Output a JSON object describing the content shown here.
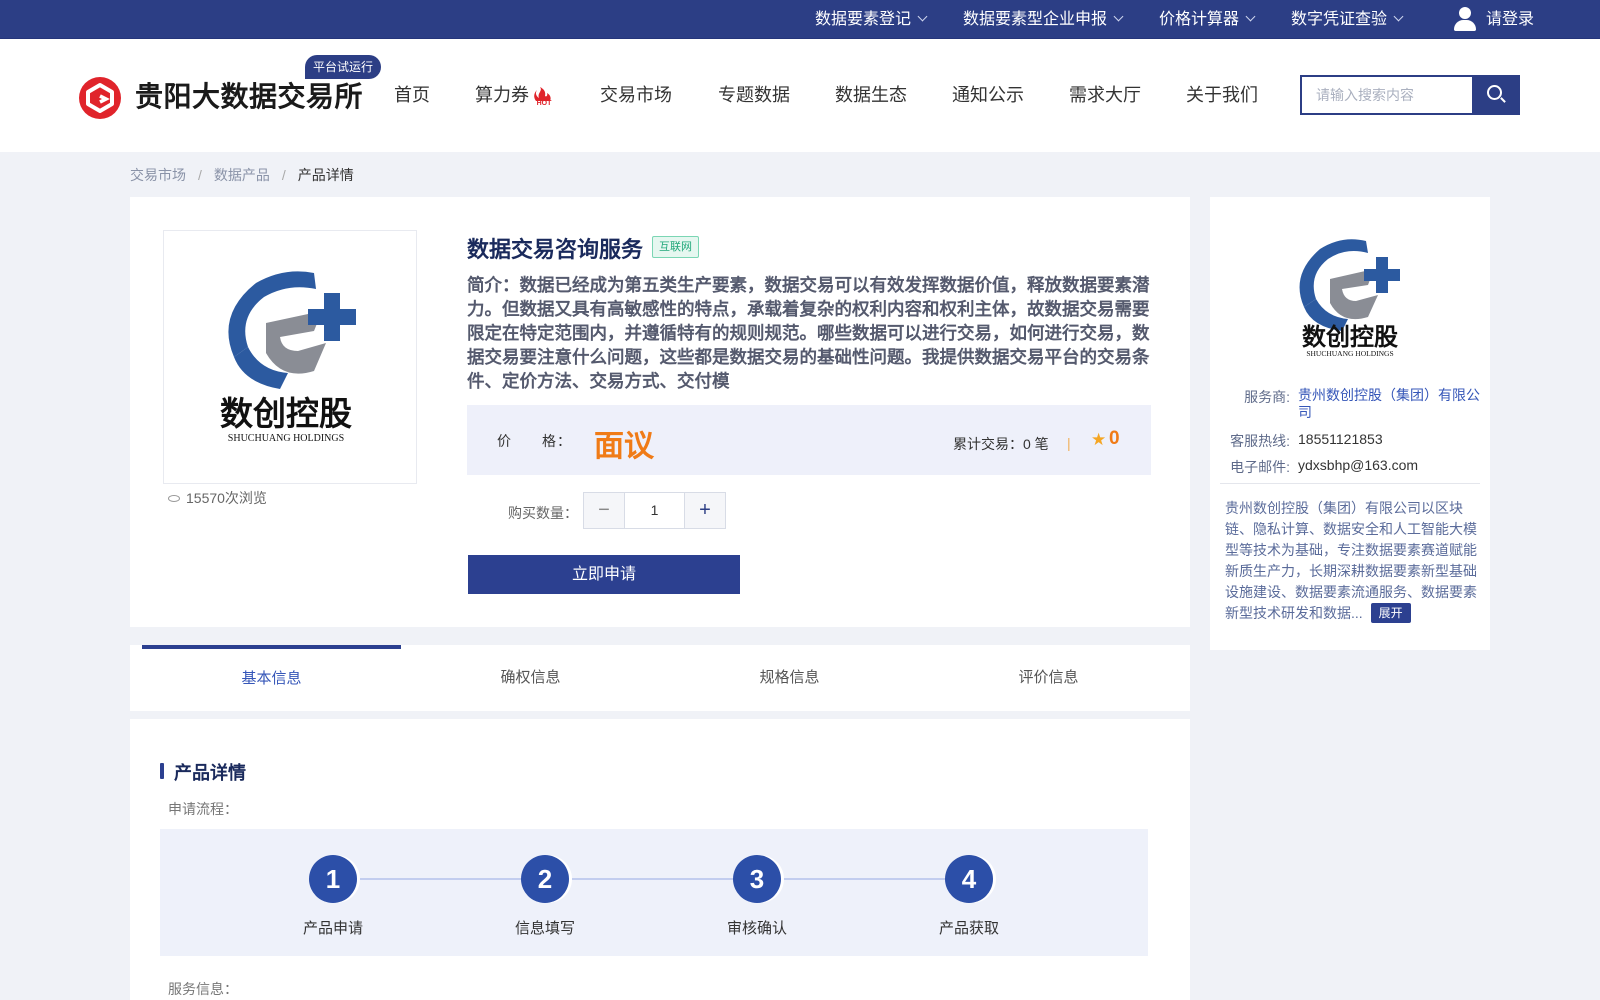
{
  "topbar": {
    "items": [
      "数据要素登记",
      "数据要素型企业申报",
      "价格计算器",
      "数字凭证查验"
    ],
    "login": "请登录"
  },
  "header": {
    "logo_text": "贵阳大数据交易所",
    "trial_badge": "平台试运行",
    "nav": [
      "首页",
      "算力券",
      "交易市场",
      "专题数据",
      "数据生态",
      "通知公示",
      "需求大厅",
      "关于我们"
    ],
    "hot_badge": "HOT",
    "search_placeholder": "请输入搜索内容"
  },
  "breadcrumb": [
    "交易市场",
    "数据产品",
    "产品详情"
  ],
  "product": {
    "logo_cn": "数创控股",
    "logo_en": "SHUCHUANG HOLDINGS",
    "views": "15570次浏览",
    "title": "数据交易咨询服务",
    "tag": "互联网",
    "description": "简介：数据已经成为第五类生产要素，数据交易可以有效发挥数据价值，释放数据要素潜力。但数据又具有高敏感性的特点，承载着复杂的权利内容和权利主体，故数据交易需要限定在特定范围内，并遵循特有的规则规范。哪些数据可以进行交易，如何进行交易，数据交易要注意什么问题，这些都是数据交易的基础性问题。我提供数据交易平台的交易条件、定价方法、交易方式、交付模",
    "price_label": "价　　格：",
    "price_value": "面议",
    "trade_count": "累计交易：0 笔",
    "rating": "0",
    "qty_label": "购买数量：",
    "qty_value": "1",
    "apply_label": "立即申请"
  },
  "provider": {
    "logo_cn": "数创控股",
    "logo_en": "SHUCHUANG HOLDINGS",
    "service_label": "服务商:",
    "service_value": "贵州数创控股（集团）有限公司",
    "hotline_label": "客服热线:",
    "hotline_value": "18551121853",
    "email_label": "电子邮件:",
    "email_value": "ydxsbhp@163.com",
    "description": "贵州数创控股（集团）有限公司以区块链、隐私计算、数据安全和人工智能大模型等技术为基础，专注数据要素赛道赋能新质生产力，长期深耕数据要素新型基础设施建设、数据要素流通服务、数据要素新型技术研发和数据...",
    "expand_label": "展开"
  },
  "tabs": [
    "基本信息",
    "确权信息",
    "规格信息",
    "评价信息"
  ],
  "detail": {
    "section_title": "产品详情",
    "flow_label": "申请流程：",
    "steps": [
      {
        "num": "1",
        "label": "产品申请"
      },
      {
        "num": "2",
        "label": "信息填写"
      },
      {
        "num": "3",
        "label": "审核确认"
      },
      {
        "num": "4",
        "label": "产品获取"
      }
    ],
    "service_label": "服务信息："
  },
  "colors": {
    "primary": "#2c3e85",
    "accent_orange": "#f07b16",
    "logo_red": "#e0242b",
    "tag_green": "#21a87a"
  }
}
